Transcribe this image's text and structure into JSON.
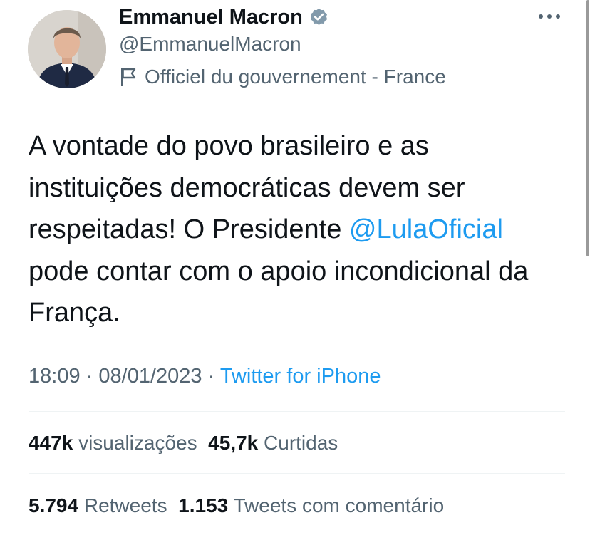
{
  "author": {
    "name": "Emmanuel Macron",
    "handle": "@EmmanuelMacron",
    "label": "Officiel du gouvernement - France",
    "verified": true,
    "avatar_icon": "profile-photo"
  },
  "tweet": {
    "text_before": "A vontade do povo brasileiro e as instituições democráticas devem ser respeitadas! O Presidente ",
    "mention": "@LulaOficial",
    "text_after": " pode contar com o apoio incondicional da França."
  },
  "meta": {
    "time": "18:09",
    "separator": "·",
    "date": "08/01/2023",
    "source": "Twitter for iPhone"
  },
  "stats": {
    "views_value": "447k",
    "views_label": "visualizações",
    "likes_value": "45,7k",
    "likes_label": "Curtidas",
    "retweets_value": "5.794",
    "retweets_label": "Retweets",
    "quotes_value": "1.153",
    "quotes_label": "Tweets com comentário"
  },
  "colors": {
    "text": "#0f1419",
    "secondary": "#536471",
    "accent": "#1d9bf0",
    "divider": "#eff3f4"
  }
}
